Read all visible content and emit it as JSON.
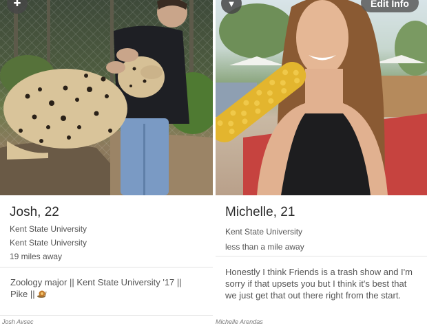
{
  "profiles": [
    {
      "name": "Josh",
      "age": ", 22",
      "school1": "Kent State University",
      "school2": "Kent State University",
      "distance": "19 miles away",
      "bio": "Zoology major || Kent State University '17 || Pike ||",
      "bio_icon": "snail-icon",
      "photo_icon": "plus-icon",
      "credit": "Josh Avsec"
    },
    {
      "name": "Michelle",
      "age": ", 21",
      "school": "Kent State University",
      "distance": "less than a mile away",
      "bio": "Honestly I think Friends is a trash show and I'm sorry if that upsets you but I think it's best that we just get that out there right from the start.",
      "photo_icon": "chevron-down-icon",
      "edit_label": "Edit Info",
      "credit": "Michelle Arendas"
    }
  ]
}
